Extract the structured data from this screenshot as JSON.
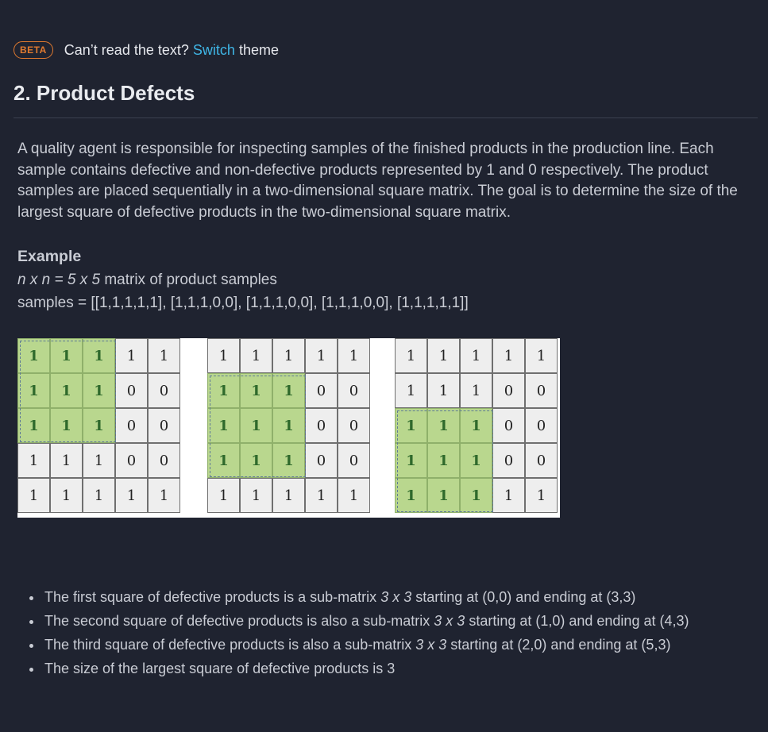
{
  "banner": {
    "badge": "BETA",
    "prefix": "Can’t read the text?",
    "link": "Switch",
    "suffix": "theme"
  },
  "problem": {
    "title": "2. Product Defects",
    "description": "A quality agent is responsible for inspecting samples of the finished products in the production line. Each sample contains defective and non-defective products represented by 1 and 0 respectively.  The product samples are placed sequentially in a two-dimensional square matrix. The goal is to determine the size of the largest square of defective products in the two-dimensional square matrix."
  },
  "example": {
    "heading": "Example",
    "dims_math": "n x n = 5 x 5",
    "dims_text": "matrix of product samples",
    "samples": "samples = [[1,1,1,1,1], [1,1,1,0,0], [1,1,1,0,0], [1,1,1,0,0], [1,1,1,1,1]]"
  },
  "matrix_values": [
    [
      1,
      1,
      1,
      1,
      1
    ],
    [
      1,
      1,
      1,
      0,
      0
    ],
    [
      1,
      1,
      1,
      0,
      0
    ],
    [
      1,
      1,
      1,
      0,
      0
    ],
    [
      1,
      1,
      1,
      1,
      1
    ]
  ],
  "highlight_starts": [
    0,
    1,
    2
  ],
  "colors": {
    "background": "#1f2330",
    "accent_link": "#3fb6e6",
    "beta_badge": "#e07a2f",
    "highlight_fill": "#b9d78e"
  },
  "notes": {
    "n1": {
      "a": "The first square of defective products is a sub-matrix",
      "m": "3 x 3",
      "b": "starting at (0,0) and ending at (3,3)"
    },
    "n2": {
      "a": "The second square of defective products is also a sub-matrix",
      "m": "3 x 3",
      "b": "starting at (1,0) and ending at (4,3)"
    },
    "n3": {
      "a": "The third square of defective products is also a sub-matrix",
      "m": "3 x 3",
      "b": "starting at (2,0) and ending at (5,3)"
    },
    "n4": "The size of the largest square of defective products is 3"
  }
}
